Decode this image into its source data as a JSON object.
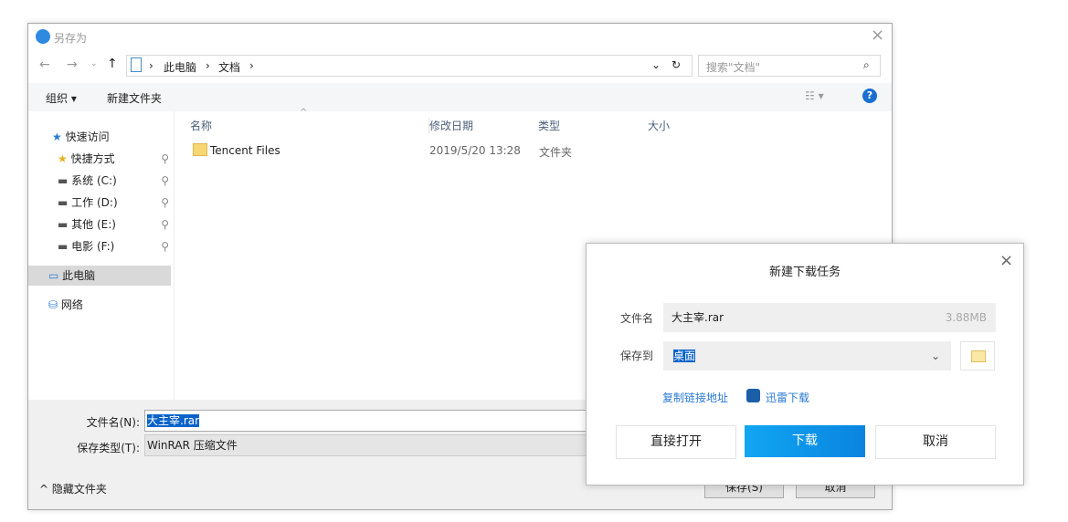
{
  "save_as": {
    "title": "另存为",
    "breadcrumb": [
      "此电脑",
      "文档"
    ],
    "search_placeholder": "搜索\"文档\"",
    "toolbar": {
      "organize": "组织 ▾",
      "new_folder": "新建文件夹"
    },
    "sidebar": {
      "quick_access": "快速访问",
      "items": [
        "快捷方式",
        "系统 (C:)",
        "工作 (D:)",
        "其他 (E:)",
        "电影 (F:)"
      ],
      "this_pc": "此电脑",
      "network": "网络"
    },
    "columns": [
      "名称",
      "修改日期",
      "类型",
      "大小"
    ],
    "rows": [
      {
        "name": "Tencent Files",
        "date": "2019/5/20 13:28",
        "type": "文件夹",
        "size": ""
      }
    ],
    "filename_label": "文件名(N):",
    "filename": "大主宰.rar",
    "filetype_label": "保存类型(T):",
    "filetype": "WinRAR 压缩文件",
    "hide_folders": "隐藏文件夹",
    "save": "保存(S)",
    "cancel": "取消"
  },
  "download": {
    "title": "新建下载任务",
    "filename_label": "文件名",
    "filename": "大主宰.rar",
    "size": "3.88MB",
    "saveto_label": "保存到",
    "saveto": "桌面",
    "copy_link": "复制链接地址",
    "thunder": "迅雷下载",
    "open": "直接打开",
    "download": "下载",
    "cancel": "取消",
    "accent": "#0a8de8"
  }
}
